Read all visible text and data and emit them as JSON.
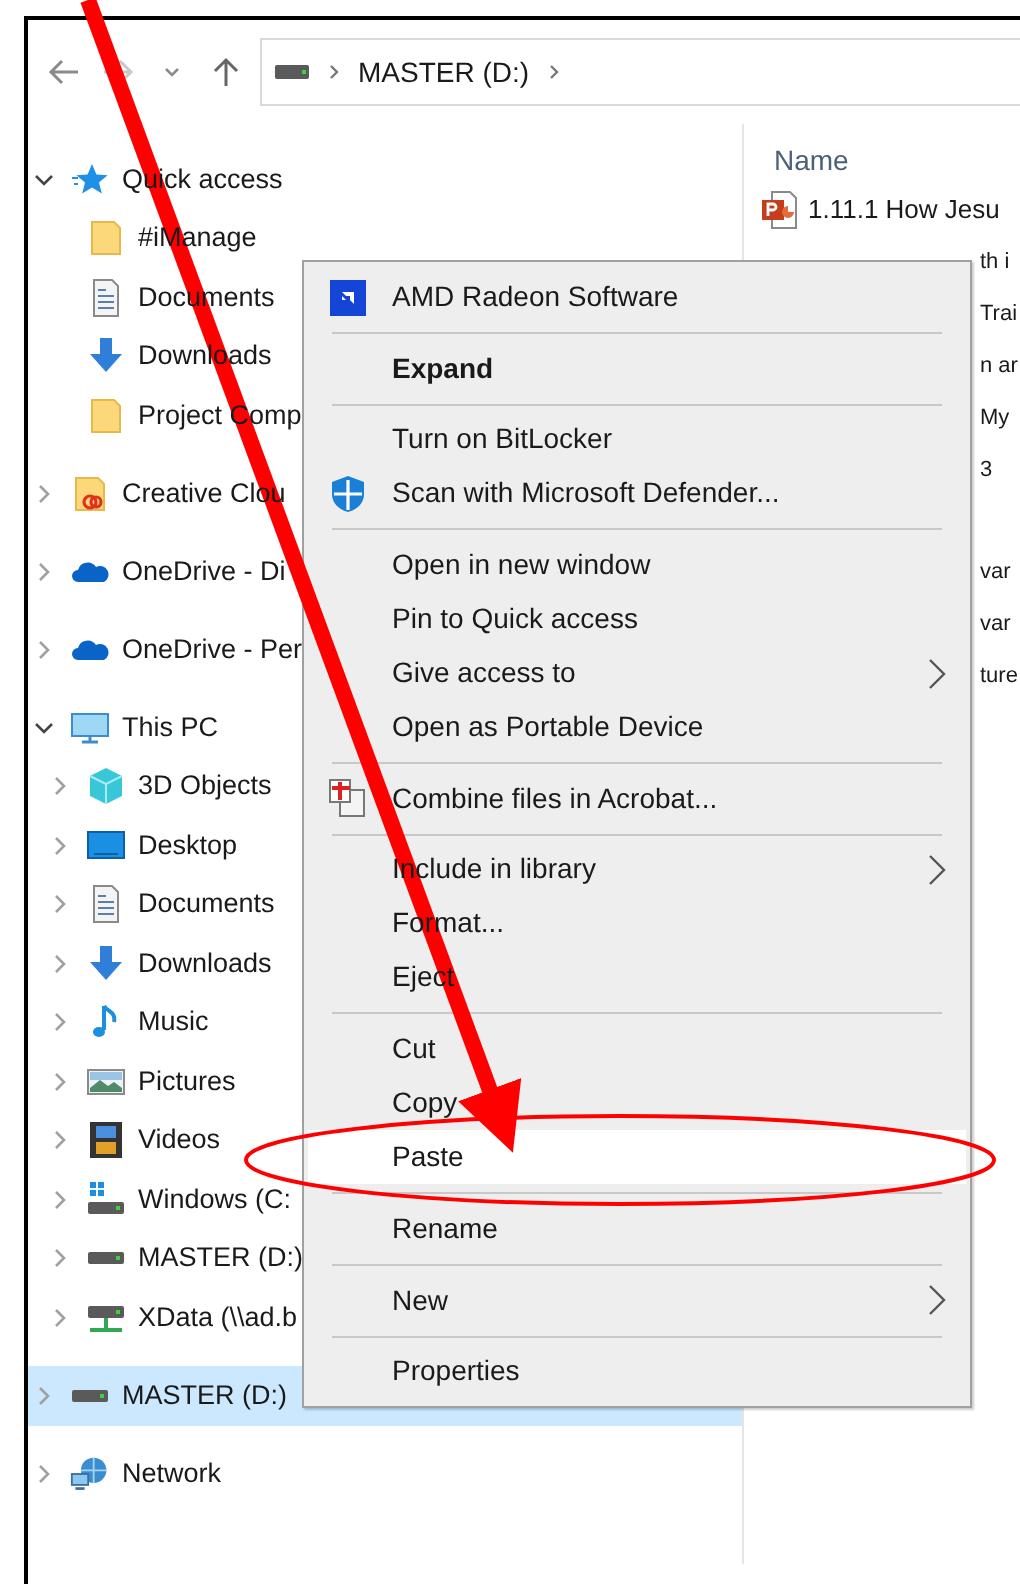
{
  "address_bar": {
    "path": "MASTER (D:)"
  },
  "sidebar": {
    "items": [
      {
        "label": "Quick access",
        "expanded": true,
        "selected": false,
        "children": [
          {
            "label": "#iManage",
            "selected": false
          },
          {
            "label": "Documents",
            "selected": false
          },
          {
            "label": "Downloads",
            "selected": false
          },
          {
            "label": "Project Comp",
            "selected": false
          }
        ]
      },
      {
        "label": "Creative Clou",
        "expanded": false,
        "selected": false
      },
      {
        "label": "OneDrive - Di",
        "expanded": false,
        "selected": false
      },
      {
        "label": "OneDrive - Per",
        "expanded": false,
        "selected": false
      },
      {
        "label": "This PC",
        "expanded": true,
        "selected": false,
        "children": [
          {
            "label": "3D Objects",
            "expanded": false,
            "selected": false
          },
          {
            "label": "Desktop",
            "expanded": false,
            "selected": false
          },
          {
            "label": "Documents",
            "expanded": false,
            "selected": false
          },
          {
            "label": "Downloads",
            "expanded": false,
            "selected": false
          },
          {
            "label": "Music",
            "expanded": false,
            "selected": false
          },
          {
            "label": "Pictures",
            "expanded": false,
            "selected": false
          },
          {
            "label": "Videos",
            "expanded": false,
            "selected": false
          },
          {
            "label": "Windows (C:",
            "expanded": false,
            "selected": false
          },
          {
            "label": "MASTER (D:)",
            "expanded": false,
            "selected": false
          },
          {
            "label": "XData (\\\\ad.b",
            "expanded": false,
            "selected": false
          }
        ]
      },
      {
        "label": "MASTER (D:)",
        "expanded": false,
        "selected": true
      },
      {
        "label": "Network",
        "expanded": false,
        "selected": false
      }
    ]
  },
  "file_list": {
    "columns": [
      "Name"
    ],
    "row_blocks": [
      [
        {
          "name": "1.11.1 How Jesu",
          "covered": false
        },
        {
          "name": "th i",
          "covered": true
        },
        {
          "name": "Trai",
          "covered": true
        },
        {
          "name": "n ar",
          "covered": true
        },
        {
          "name": "My",
          "covered": true
        },
        {
          "name": "3",
          "covered": true
        }
      ],
      [
        {
          "name": "var",
          "covered": true
        },
        {
          "name": "var",
          "covered": true
        },
        {
          "name": "ture",
          "covered": true
        }
      ]
    ]
  },
  "context_menu": {
    "groups": [
      [
        {
          "label": "AMD Radeon Software",
          "submenu": false,
          "selected": false
        }
      ],
      [
        {
          "label": "Expand",
          "default": true,
          "submenu": false,
          "selected": false
        }
      ],
      [
        {
          "label": "Turn on BitLocker",
          "submenu": false,
          "selected": false
        },
        {
          "label": "Scan with Microsoft Defender...",
          "submenu": false,
          "selected": false
        }
      ],
      [
        {
          "label": "Open in new window",
          "submenu": false,
          "selected": false
        },
        {
          "label": "Pin to Quick access",
          "submenu": false,
          "selected": false
        },
        {
          "label": "Give access to",
          "submenu": true,
          "selected": false
        },
        {
          "label": "Open as Portable Device",
          "submenu": false,
          "selected": false
        }
      ],
      [
        {
          "label": "Combine files in Acrobat...",
          "submenu": false,
          "selected": false
        }
      ],
      [
        {
          "label": "Include in library",
          "submenu": true,
          "selected": false
        },
        {
          "label": "Format...",
          "submenu": false,
          "selected": false
        },
        {
          "label": "Eject",
          "submenu": false,
          "selected": false
        }
      ],
      [
        {
          "label": "Cut",
          "submenu": false,
          "selected": false
        },
        {
          "label": "Copy",
          "submenu": false,
          "selected": false
        },
        {
          "label": "Paste",
          "submenu": false,
          "selected": true
        }
      ],
      [
        {
          "label": "Rename",
          "submenu": false,
          "selected": false
        }
      ],
      [
        {
          "label": "New",
          "submenu": true,
          "selected": false
        }
      ],
      [
        {
          "label": "Properties",
          "submenu": false,
          "selected": false
        }
      ]
    ]
  },
  "arrow": {
    "color": "#ff0000"
  },
  "highlight_ring": {
    "color": "#ff0000"
  }
}
